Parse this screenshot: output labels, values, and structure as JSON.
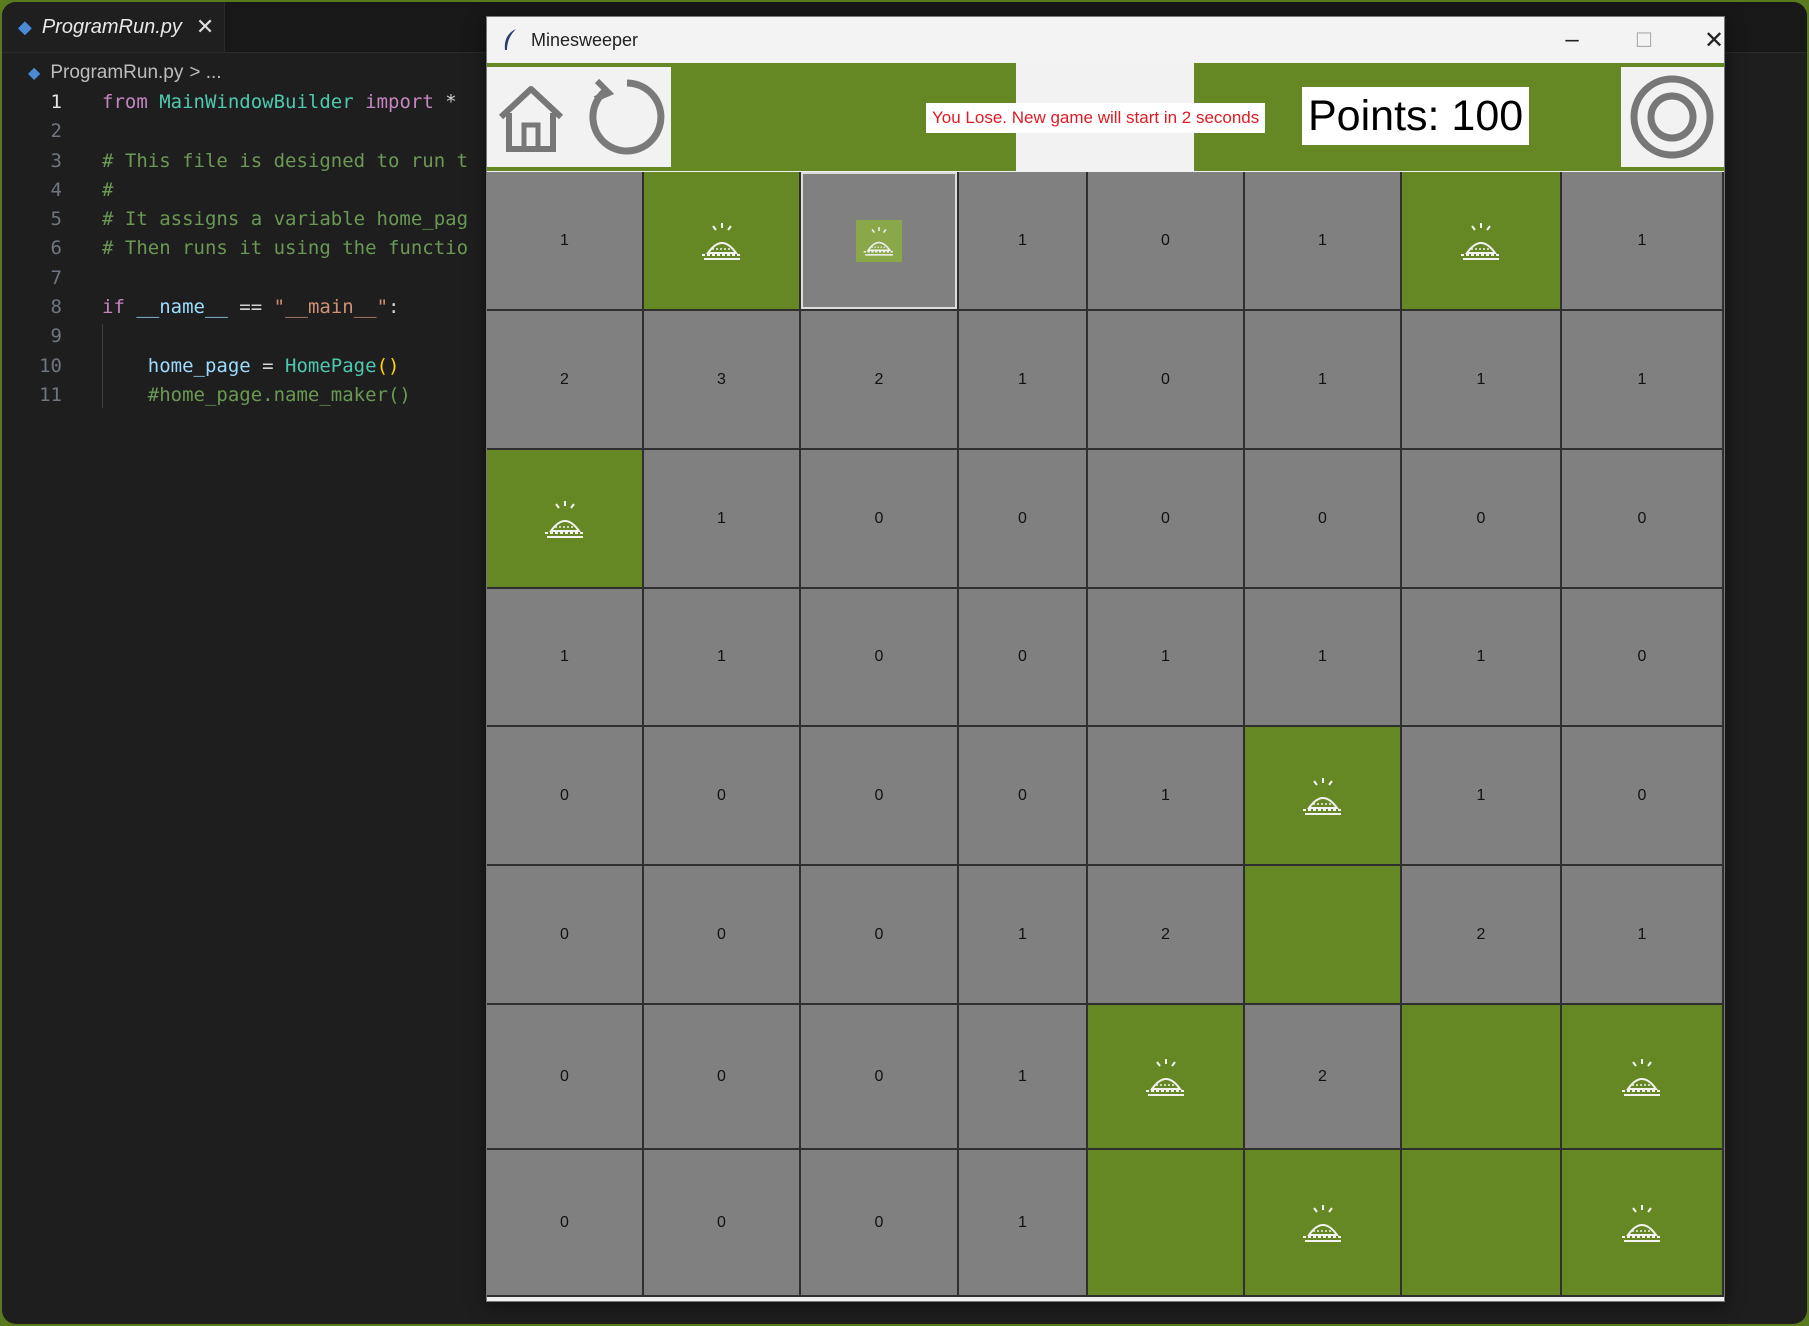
{
  "editor": {
    "tab_label": "ProgramRun.py",
    "tab_close": "✕",
    "breadcrumb_file": "ProgramRun.py",
    "breadcrumb_rest": "> ...",
    "lines": [
      {
        "n": "1",
        "parts": [
          [
            "kw",
            "from"
          ],
          [
            "op",
            " "
          ],
          [
            "cls",
            "MainWindowBuilder"
          ],
          [
            "op",
            " "
          ],
          [
            "kw",
            "import"
          ],
          [
            "op",
            " *"
          ]
        ]
      },
      {
        "n": "2",
        "parts": []
      },
      {
        "n": "3",
        "parts": [
          [
            "cm",
            "# This file is designed to run t"
          ]
        ]
      },
      {
        "n": "4",
        "parts": [
          [
            "cm",
            "#"
          ]
        ]
      },
      {
        "n": "5",
        "parts": [
          [
            "cm",
            "# It assigns a variable home_pag"
          ]
        ]
      },
      {
        "n": "6",
        "parts": [
          [
            "cm",
            "# Then runs it using the functio"
          ]
        ]
      },
      {
        "n": "7",
        "parts": []
      },
      {
        "n": "8",
        "parts": [
          [
            "kw",
            "if"
          ],
          [
            "op",
            " "
          ],
          [
            "var",
            "__name__"
          ],
          [
            "op",
            " == "
          ],
          [
            "str",
            "\"__main__\""
          ],
          [
            "op",
            ":"
          ]
        ]
      },
      {
        "n": "9",
        "parts": []
      },
      {
        "n": "10",
        "parts": [
          [
            "op",
            "    "
          ],
          [
            "var",
            "home_page"
          ],
          [
            "op",
            " = "
          ],
          [
            "fn",
            "HomePage"
          ],
          [
            "br",
            "()"
          ]
        ]
      },
      {
        "n": "11",
        "parts": [
          [
            "op",
            "    "
          ],
          [
            "cm",
            "#home_page.name_maker()"
          ]
        ]
      }
    ]
  },
  "window": {
    "title": "Minesweeper",
    "minimize": "–",
    "maximize": "☐",
    "close": "✕",
    "status_message": "You Lose. New game will start in 2 seconds",
    "points_text": "Points: 100",
    "buttons": [
      "home-icon",
      "restart-icon",
      "target-icon"
    ]
  },
  "colors": {
    "accent_green": "#658824",
    "cell_gray": "#808080",
    "message_red": "#e01b24"
  },
  "board": {
    "rows": [
      [
        "1",
        "M",
        "S",
        "1",
        "0",
        "1",
        "M",
        "1"
      ],
      [
        "2",
        "3",
        "2",
        "1",
        "0",
        "1",
        "1",
        "1"
      ],
      [
        "M",
        "1",
        "0",
        "0",
        "0",
        "0",
        "0",
        "0"
      ],
      [
        "1",
        "1",
        "0",
        "0",
        "1",
        "1",
        "1",
        "0"
      ],
      [
        "0",
        "0",
        "0",
        "0",
        "1",
        "M",
        "1",
        "0"
      ],
      [
        "0",
        "0",
        "0",
        "1",
        "2",
        "G",
        "2",
        "1"
      ],
      [
        "0",
        "0",
        "0",
        "1",
        "M",
        "2",
        "G",
        "M"
      ],
      [
        "0",
        "0",
        "0",
        "1",
        "G",
        "M",
        "G",
        "M"
      ]
    ]
  }
}
